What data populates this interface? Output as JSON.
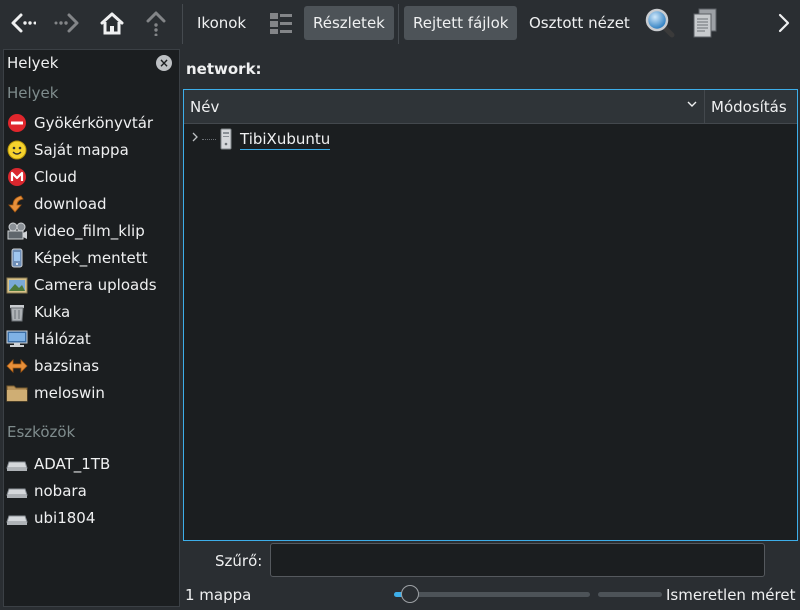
{
  "toolbar": {
    "back_icon": "arrow-left-icon",
    "forward_icon": "arrow-right-icon",
    "home_icon": "home-icon",
    "up_icon": "arrow-up-icon",
    "icons_label": "Ikonok",
    "compact_icon": "view-list-icon",
    "details_label": "Részletek",
    "hidden_label": "Rejtett fájlok",
    "split_label": "Osztott nézet",
    "search_icon": "magnifier-icon",
    "panel_icon": "documents-icon",
    "more_icon": "chevron-right-icon"
  },
  "sidebar": {
    "title": "Helyek",
    "places_section": "Helyek",
    "places": [
      {
        "label": "Gyökérkönyvtár",
        "icon": "root-folder-icon"
      },
      {
        "label": "Saját mappa",
        "icon": "smiley-icon"
      },
      {
        "label": "Cloud",
        "icon": "mega-icon"
      },
      {
        "label": "download",
        "icon": "download-icon"
      },
      {
        "label": "video_film_klip",
        "icon": "film-icon"
      },
      {
        "label": "Képek_mentett",
        "icon": "phone-icon"
      },
      {
        "label": "Camera uploads",
        "icon": "image-icon"
      },
      {
        "label": "Kuka",
        "icon": "trash-icon"
      },
      {
        "label": "Hálózat",
        "icon": "network-icon"
      },
      {
        "label": "bazsinas",
        "icon": "share-icon"
      },
      {
        "label": "meloswin",
        "icon": "folder-icon"
      }
    ],
    "devices_section": "Eszközök",
    "devices": [
      {
        "label": "ADAT_1TB",
        "icon": "drive-icon"
      },
      {
        "label": "nobara",
        "icon": "drive-icon"
      },
      {
        "label": "ubi1804",
        "icon": "drive-icon"
      }
    ]
  },
  "main": {
    "path": "network:",
    "columns": {
      "name": "Név",
      "modified": "Módosítás"
    },
    "rows": [
      {
        "name": "TibiXubuntu",
        "icon": "computer-tower-icon"
      }
    ]
  },
  "filter": {
    "label": "Szűrő:",
    "value": "",
    "placeholder": ""
  },
  "status": {
    "folder_count": "1 mappa",
    "zoom_level": 0.08,
    "free_space": "Ismeretlen méret"
  },
  "colors": {
    "accent": "#3daee9",
    "background": "#2a2e32",
    "view": "#1b1e20"
  }
}
